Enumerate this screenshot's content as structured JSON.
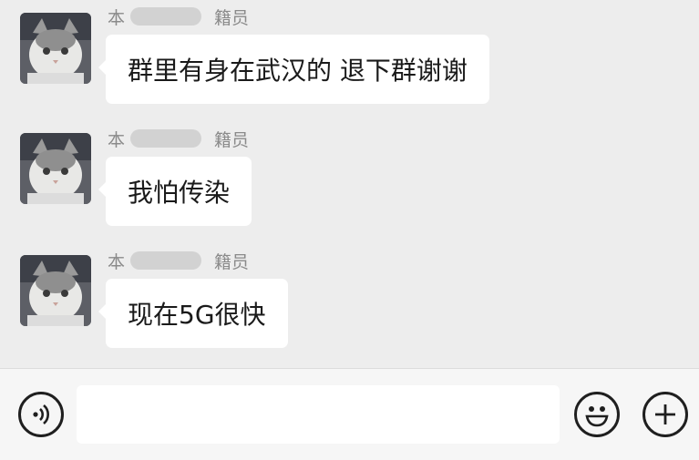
{
  "messages": [
    {
      "sender_prefix": "本",
      "sender_suffix": "籍员",
      "text": "群里有身在武汉的 退下群谢谢"
    },
    {
      "sender_prefix": "本",
      "sender_suffix": "籍员",
      "text": "我怕传染"
    },
    {
      "sender_prefix": "本",
      "sender_suffix": "籍员",
      "text": "现在5G很快"
    }
  ],
  "icons": {
    "voice": "voice-icon",
    "emoji": "emoji-icon",
    "plus": "plus-icon",
    "avatar": "cat-avatar"
  },
  "colors": {
    "background": "#ededed",
    "bubble": "#ffffff",
    "input_bar": "#f6f6f6"
  }
}
